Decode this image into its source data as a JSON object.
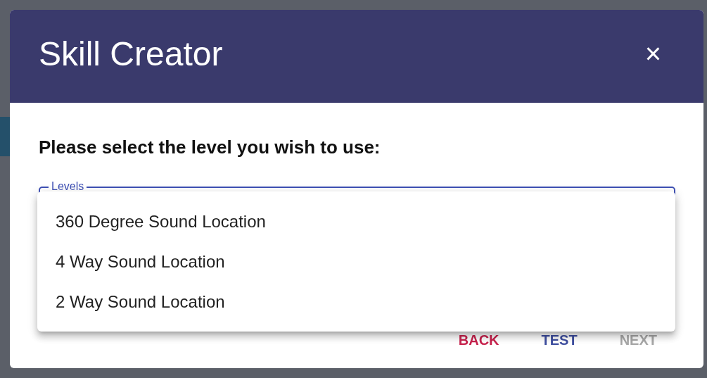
{
  "dialog": {
    "title": "Skill Creator",
    "close": "×",
    "prompt": "Please select the level you wish to use:",
    "field": {
      "label": "Levels",
      "focused": true
    },
    "menu": {
      "open": true,
      "options": [
        {
          "label": "360 Degree Sound Location",
          "selected": false
        },
        {
          "label": "4 Way Sound Location",
          "selected": false
        },
        {
          "label": "2 Way Sound Location",
          "selected": false
        }
      ]
    },
    "buttons": [
      {
        "label": "BACK",
        "kind": "danger",
        "disabled": false
      },
      {
        "label": "TEST",
        "kind": "primary",
        "disabled": false
      },
      {
        "label": "NEXT",
        "kind": "primary",
        "disabled": true
      }
    ]
  }
}
